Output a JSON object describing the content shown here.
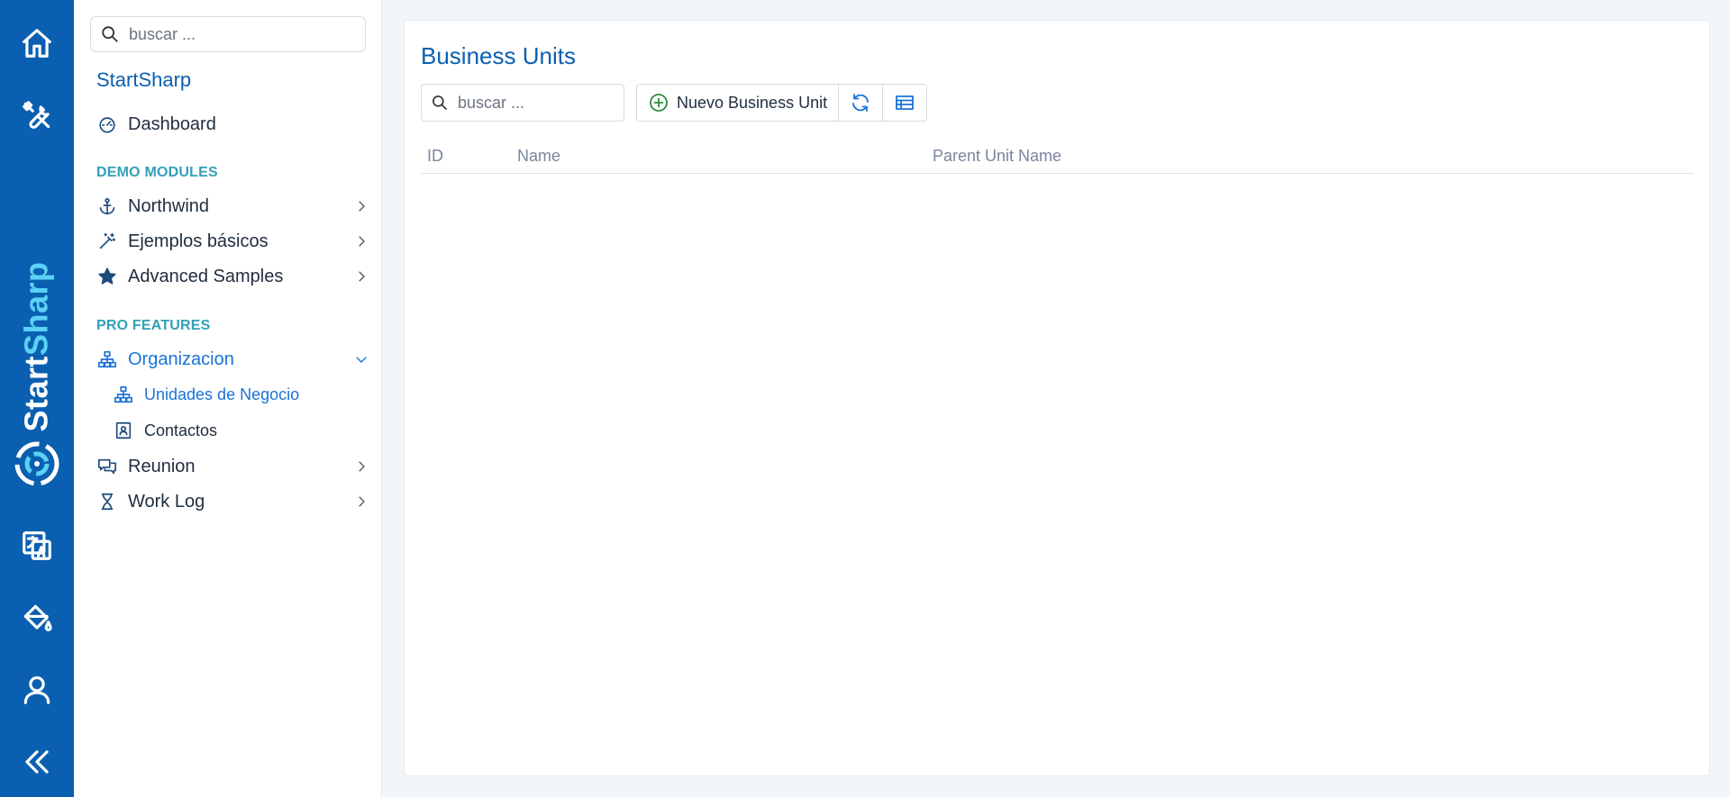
{
  "rail": {
    "brand_white": "Start",
    "brand_cyan": "Sharp",
    "icons": [
      "home-icon",
      "tools-icon",
      "translate-icon",
      "paint-bucket-icon",
      "user-icon",
      "collapse-icon"
    ]
  },
  "sidebar": {
    "search_placeholder": "buscar ...",
    "title": "StartSharp",
    "dashboard": "Dashboard",
    "section_demo": "DEMO MODULES",
    "northwind": "Northwind",
    "basic_samples": "Ejemplos básicos",
    "advanced_samples": "Advanced Samples",
    "section_pro": "PRO FEATURES",
    "organizacion": "Organizacion",
    "business_units": "Unidades de Negocio",
    "contactos": "Contactos",
    "reunion": "Reunion",
    "work_log": "Work Log"
  },
  "main": {
    "title": "Business Units",
    "search_placeholder": "buscar ...",
    "new_button": "Nuevo Business Unit",
    "columns": {
      "id": "ID",
      "name": "Name",
      "parent": "Parent Unit Name"
    }
  },
  "colors": {
    "rail": "#0b5fb0",
    "accent": "#1a73d8",
    "section": "#33a0b8",
    "brand_cyan": "#5ad1f5"
  }
}
